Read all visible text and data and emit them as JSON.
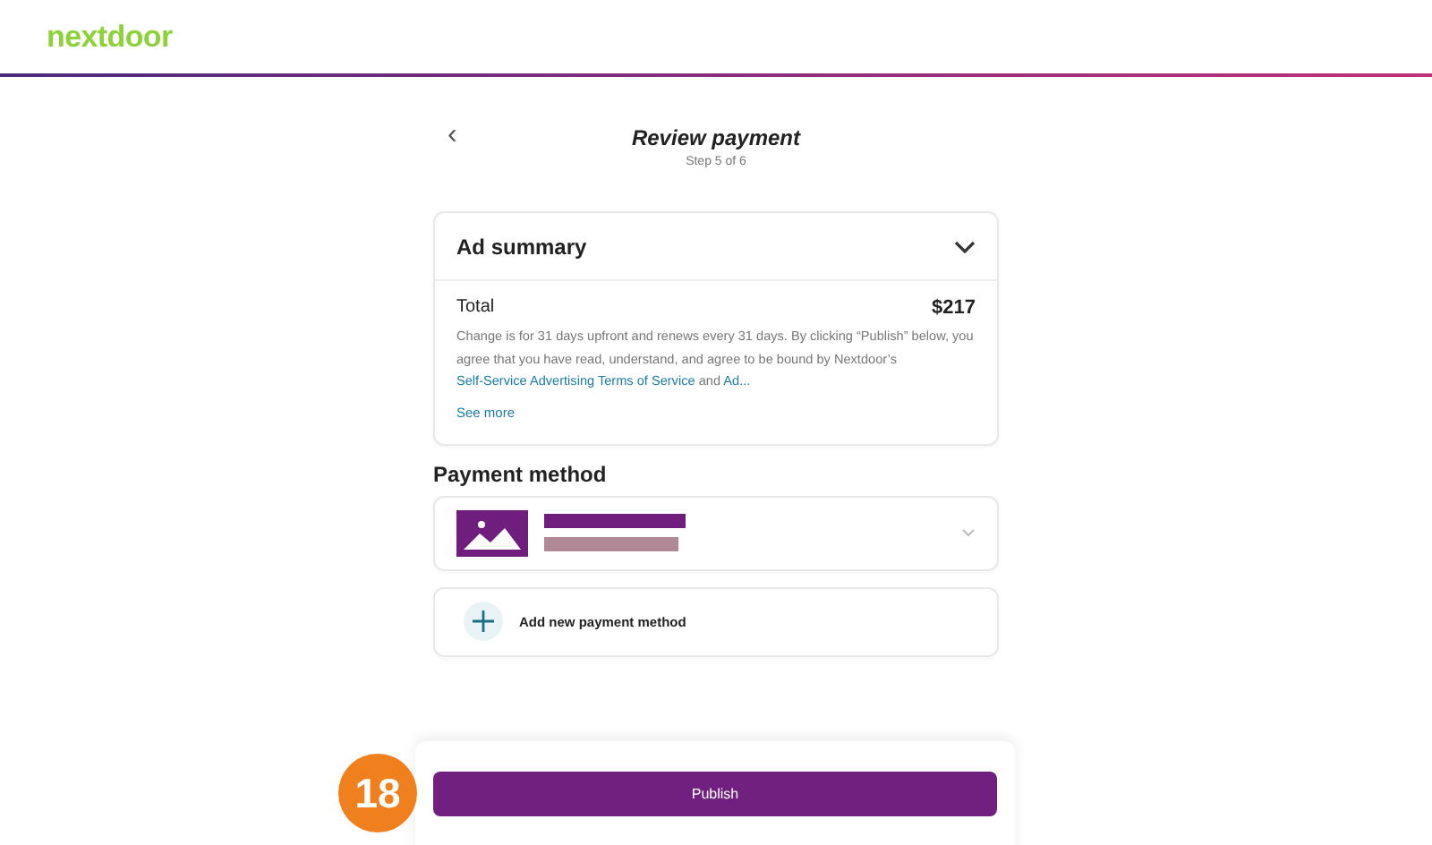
{
  "header": {
    "logo": "nextdoor"
  },
  "page": {
    "back": "‹",
    "title": "Review payment",
    "step": "Step 5 of 6"
  },
  "summary": {
    "title": "Ad summary",
    "expanded": true,
    "total_label": "Total",
    "total": "$217",
    "terms": "Change is for 31 days upfront and renews every 31 days. By clicking “Publish” below, you agree that you have read, understand, and agree to be bound by Nextdoor’s",
    "terms_link": "Self-Service Advertising Terms of Service",
    "terms_and": "and",
    "terms_link_2": "Ad...",
    "see_more": "See more"
  },
  "payment": {
    "title": "Payment method",
    "add_label": "Add new payment method"
  },
  "footer": {
    "button": "Publish",
    "badge": "18"
  }
}
